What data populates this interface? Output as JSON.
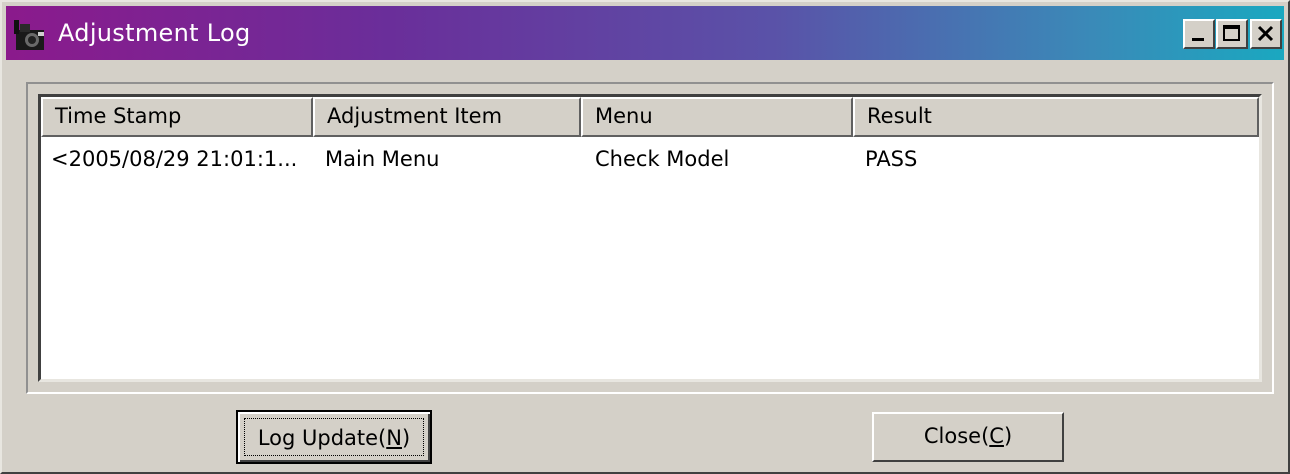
{
  "window": {
    "title": "Adjustment Log",
    "icon": "camera-icon",
    "controls": [
      "minimize-icon",
      "maximize-icon",
      "close-icon"
    ]
  },
  "log_table": {
    "columns": [
      "Time Stamp",
      "Adjustment Item",
      "Menu",
      "Result"
    ],
    "rows": [
      [
        "<2005/08/29 21:01:1...",
        "Main Menu",
        "Check Model",
        "PASS"
      ]
    ]
  },
  "buttons": {
    "log_update_label": "Log Update(",
    "log_update_mnemonic": "N",
    "close_label": "Close(",
    "close_mnemonic": "C",
    "paren_close": ")"
  },
  "colors": {
    "titlebar_start": "#8b1a8c",
    "titlebar_end": "#1aa8c0",
    "face": "#d4d0c8"
  }
}
